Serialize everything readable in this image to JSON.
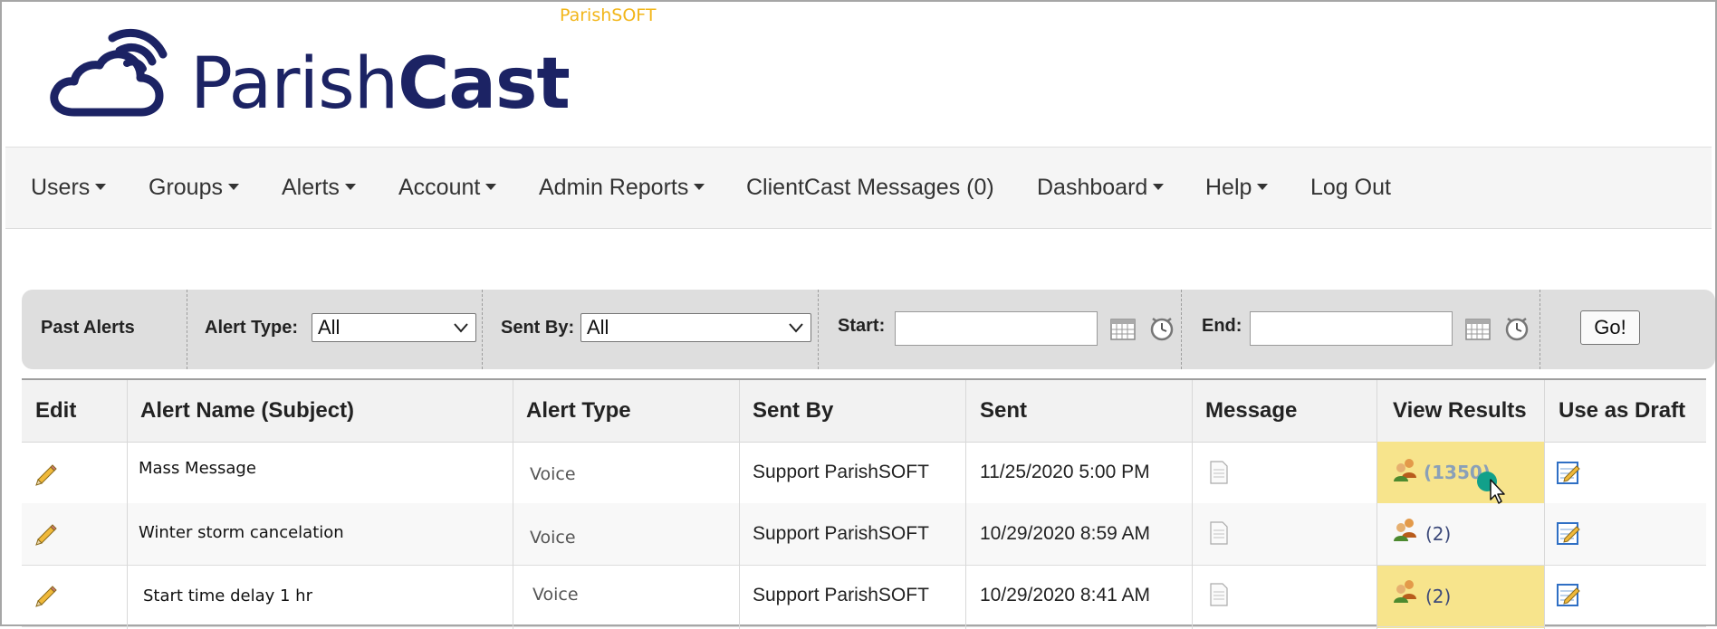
{
  "brand_top": "ParishSOFT",
  "logo": {
    "part1": "Parish",
    "part2": "Cast"
  },
  "nav": {
    "items": [
      {
        "label": "Users",
        "dropdown": true
      },
      {
        "label": "Groups",
        "dropdown": true
      },
      {
        "label": "Alerts",
        "dropdown": true
      },
      {
        "label": "Account",
        "dropdown": true
      },
      {
        "label": "Admin Reports",
        "dropdown": true
      },
      {
        "label": "ClientCast Messages (0)",
        "dropdown": false
      },
      {
        "label": "Dashboard",
        "dropdown": true
      },
      {
        "label": "Help",
        "dropdown": true
      },
      {
        "label": "Log Out",
        "dropdown": false
      }
    ]
  },
  "filter": {
    "title": "Past Alerts",
    "alert_type_label": "Alert Type:",
    "alert_type_value": "All",
    "sent_by_label": "Sent By:",
    "sent_by_value": "All",
    "start_label": "Start:",
    "start_value": "",
    "end_label": "End:",
    "end_value": "",
    "go_label": "Go!"
  },
  "table": {
    "headers": [
      "Edit",
      "Alert Name (Subject)",
      "Alert Type",
      "Sent By",
      "Sent",
      "Message",
      "View Results",
      "Use as Draft"
    ],
    "rows": [
      {
        "name": "Mass Message",
        "type": "Voice",
        "sent_by": "Support ParishSOFT",
        "sent": "11/25/2020 5:00 PM",
        "results": "(1350)"
      },
      {
        "name": "Winter storm cancelation",
        "type": "Voice",
        "sent_by": "Support ParishSOFT",
        "sent": "10/29/2020 8:59 AM",
        "results": "(2)"
      },
      {
        "name": "Start time delay 1 hr",
        "type": "Voice",
        "sent_by": "Support ParishSOFT",
        "sent": "10/29/2020 8:41 AM",
        "results": "(2)"
      }
    ]
  },
  "colors": {
    "brand_navy": "#1c2364",
    "brand_gold": "#f2b61a",
    "highlight": "#f7e48c",
    "cursor_dot": "#12a08a"
  },
  "icons": [
    "cloud-signal-logo-icon",
    "caret-down-icon",
    "calendar-icon",
    "clock-icon",
    "pencil-icon",
    "document-icon",
    "people-icon",
    "edit-note-icon",
    "mouse-cursor-icon"
  ]
}
